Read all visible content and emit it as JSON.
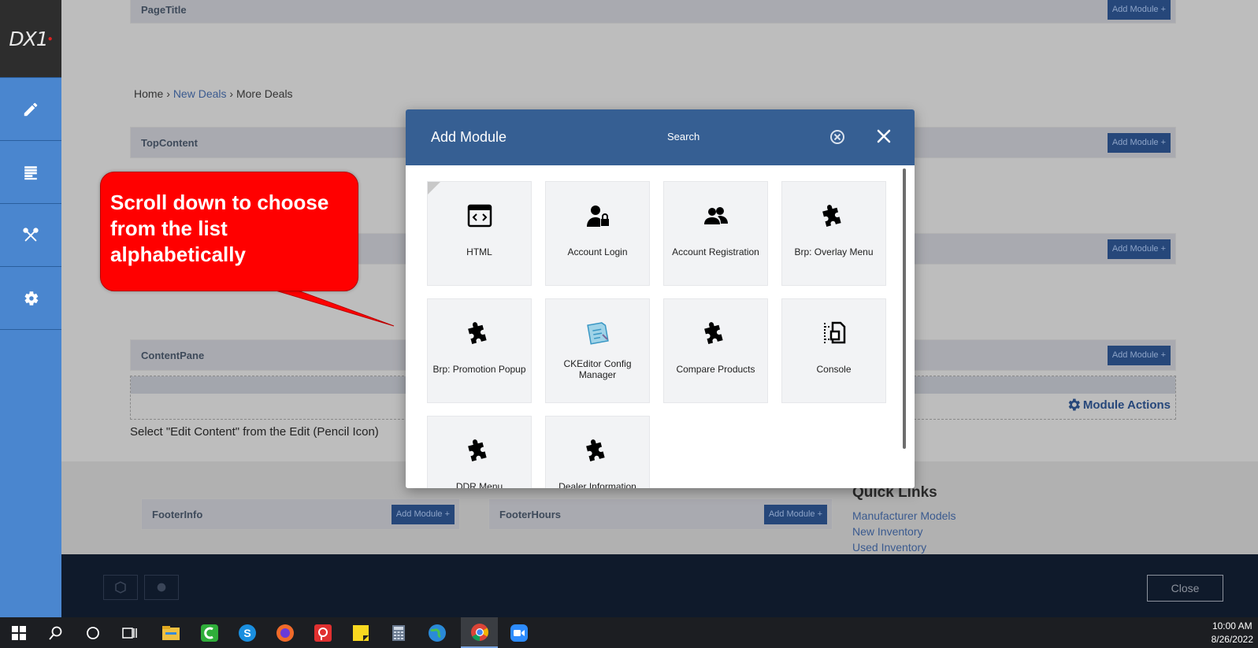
{
  "sidebar": {
    "logo": "DX1",
    "items": [
      {
        "name": "edit",
        "icon": "pencil-icon"
      },
      {
        "name": "content",
        "icon": "page-lines-icon"
      },
      {
        "name": "tools",
        "icon": "wrench-screwdriver-icon"
      },
      {
        "name": "settings",
        "icon": "gear-icon"
      }
    ]
  },
  "page": {
    "panes": [
      {
        "title": "PageTitle",
        "add": "Add Module +"
      },
      {
        "title": "TopContent",
        "add": "Add Module +"
      },
      {
        "title": "",
        "add": "Add Module +"
      },
      {
        "title": "ContentPane",
        "add": "Add Module +"
      }
    ],
    "breadcrumb": {
      "home": "Home",
      "sep1": "›",
      "new_deals": "New Deals",
      "sep2": "›",
      "current": "More Deals"
    },
    "module_actions": "Module Actions",
    "select_note": "Select \"Edit Content\" from the Edit (Pencil Icon)",
    "footer": {
      "info": {
        "title": "FooterInfo",
        "add": "Add Module +"
      },
      "hours": {
        "title": "FooterHours",
        "add": "Add Module +"
      }
    },
    "quick_links": {
      "title": "Quick Links",
      "items": [
        "Manufacturer Models",
        "New Inventory",
        "Used Inventory"
      ]
    },
    "close_label": "Close"
  },
  "callout": {
    "text": "Scroll down to choose from the list alphabetically",
    "color": "#ff0000"
  },
  "modal": {
    "title": "Add Module",
    "search_placeholder": "Search",
    "header_color": "#365f93",
    "modules": [
      {
        "label": "HTML",
        "icon": "html-code-icon"
      },
      {
        "label": "Account Login",
        "icon": "user-lock-icon"
      },
      {
        "label": "Account Registration",
        "icon": "users-icon"
      },
      {
        "label": "Brp: Overlay Menu",
        "icon": "puzzle-icon"
      },
      {
        "label": "Brp: Promotion Popup",
        "icon": "puzzle-icon"
      },
      {
        "label": "CKEditor Config Manager",
        "icon": "ckeditor-icon"
      },
      {
        "label": "Compare Products",
        "icon": "puzzle-icon"
      },
      {
        "label": "Console",
        "icon": "console-icon"
      },
      {
        "label": "DDR Menu",
        "icon": "puzzle-icon"
      },
      {
        "label": "Dealer Information",
        "icon": "puzzle-icon"
      }
    ]
  },
  "taskbar": {
    "apps": [
      "windows-start-icon",
      "search-icon",
      "cortana-icon",
      "task-view-icon",
      "file-explorer-icon",
      "camtasia-icon",
      "skype-icon",
      "firefox-icon",
      "presenter-icon",
      "sticky-notes-icon",
      "calculator-icon",
      "globe-app-icon",
      "chrome-icon",
      "zoom-icon"
    ],
    "time": "10:00 AM",
    "date": "8/26/2022"
  }
}
